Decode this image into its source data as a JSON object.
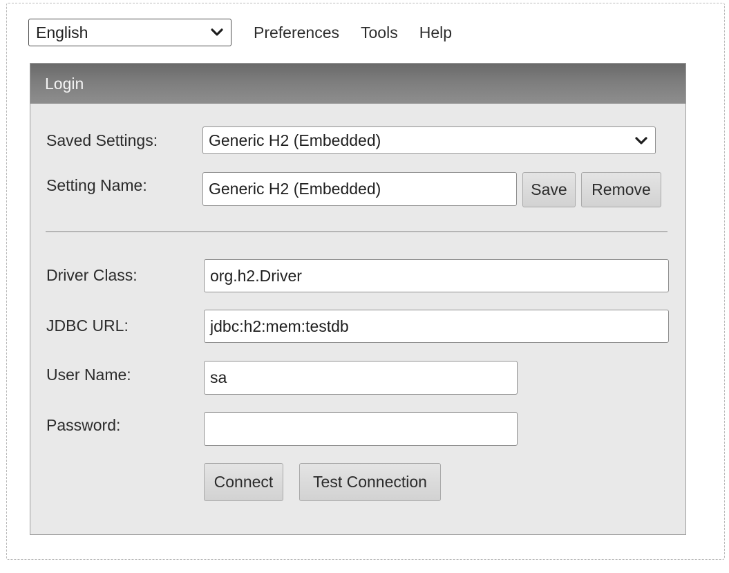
{
  "topbar": {
    "language": "English",
    "menu": [
      "Preferences",
      "Tools",
      "Help"
    ]
  },
  "login": {
    "title": "Login",
    "saved_settings_label": "Saved Settings:",
    "saved_settings_value": "Generic H2 (Embedded)",
    "setting_name_label": "Setting Name:",
    "setting_name_value": "Generic H2 (Embedded)",
    "save_label": "Save",
    "remove_label": "Remove",
    "driver_class_label": "Driver Class:",
    "driver_class_value": "org.h2.Driver",
    "jdbc_url_label": "JDBC URL:",
    "jdbc_url_value": "jdbc:h2:mem:testdb",
    "user_name_label": "User Name:",
    "user_name_value": "sa",
    "password_label": "Password:",
    "password_value": "",
    "connect_label": "Connect",
    "test_connection_label": "Test Connection"
  },
  "colors": {
    "header_gradient": "#6a6a6a",
    "panel_bg": "#e9e9e9",
    "button_bg": "#dcdcdc"
  },
  "icons": [
    "chevron-down-icon"
  ]
}
